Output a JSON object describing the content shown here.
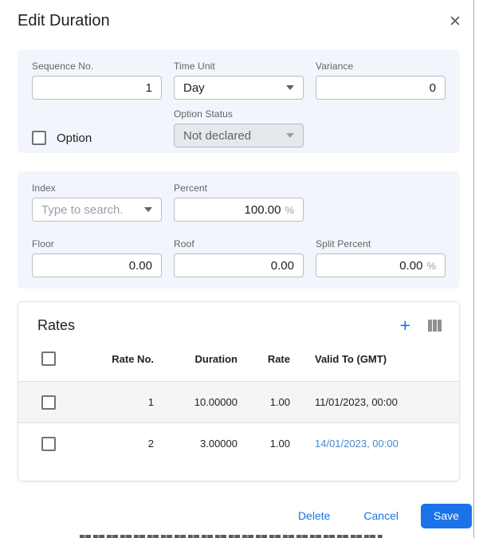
{
  "dialog": {
    "title": "Edit Duration"
  },
  "icons": {
    "close": "✕",
    "add": "+"
  },
  "form": {
    "sequence_no": {
      "label": "Sequence No.",
      "value": "1"
    },
    "time_unit": {
      "label": "Time Unit",
      "value": "Day"
    },
    "variance": {
      "label": "Variance",
      "value": "0"
    },
    "option": {
      "label": "Option",
      "checked": false
    },
    "option_status": {
      "label": "Option Status",
      "value": "Not declared",
      "disabled": true
    },
    "index": {
      "label": "Index",
      "placeholder": "Type to search."
    },
    "percent": {
      "label": "Percent",
      "value": "100.00",
      "suffix": "%"
    },
    "floor": {
      "label": "Floor",
      "value": "0.00"
    },
    "roof": {
      "label": "Roof",
      "value": "0.00"
    },
    "split_percent": {
      "label": "Split Percent",
      "value": "0.00",
      "suffix": "%"
    }
  },
  "rates": {
    "title": "Rates",
    "columns": [
      "Rate No.",
      "Duration",
      "Rate",
      "Valid To (GMT)"
    ],
    "rows": [
      {
        "rate_no": "1",
        "duration": "10.00000",
        "rate": "1.00",
        "valid_to": "11/01/2023, 00:00"
      },
      {
        "rate_no": "2",
        "duration": "3.00000",
        "rate": "1.00",
        "valid_to": "14/01/2023, 00:00"
      }
    ]
  },
  "footer": {
    "delete_label": "Delete",
    "cancel_label": "Cancel",
    "save_label": "Save"
  },
  "colors": {
    "accent_blue": "#1a73e8",
    "link_blue": "#4789c8",
    "section_bg": "#f2f6fc",
    "row_alt_bg": "#f5f5f5"
  }
}
